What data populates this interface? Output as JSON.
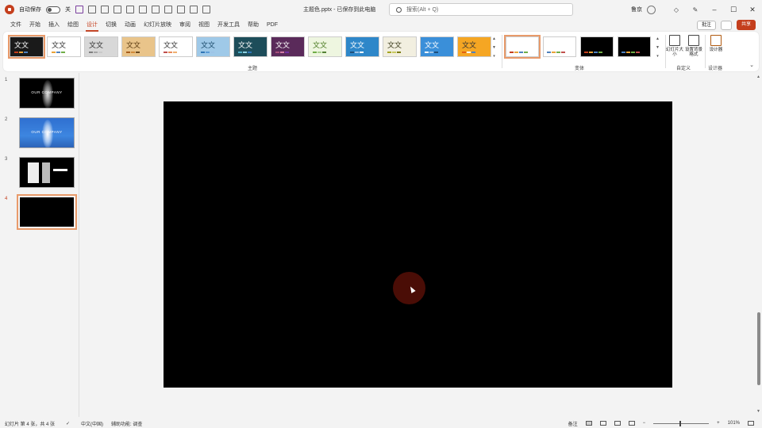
{
  "titlebar": {
    "autosave_label": "自动保存",
    "autosave_state": "关",
    "filename": "主题色.pptx - 已保存到此电脑",
    "search_placeholder": "搜索(Alt + Q)",
    "user_name": "鲁京",
    "win_min": "–",
    "win_max": "☐",
    "win_close": "✕"
  },
  "tabs": [
    "文件",
    "开始",
    "插入",
    "绘图",
    "设计",
    "切换",
    "动画",
    "幻灯片放映",
    "审阅",
    "视图",
    "开发工具",
    "帮助",
    "PDF"
  ],
  "active_tab": "设计",
  "share": {
    "comment": "批注",
    "share": "共享"
  },
  "ribbon": {
    "theme_label": "文文",
    "themes_group_label": "主题",
    "variants_group_label": "变体",
    "customize_group_label": "自定义",
    "designer_group_label": "设计器",
    "slide_size_label": "幻灯片大小",
    "format_bg_label": "设置背景格式",
    "designer_label": "设计器",
    "themes": [
      {
        "bg": "#1a1a1a",
        "fg": "#ffffff",
        "bars": [
          "#c43e1c",
          "#e8a33a",
          "#4f81bd"
        ]
      },
      {
        "bg": "#ffffff",
        "fg": "#333333",
        "bars": [
          "#e8a33a",
          "#4f81bd",
          "#70ad47"
        ]
      },
      {
        "bg": "#d8d8d8",
        "fg": "#333333",
        "bars": [
          "#7f7f7f",
          "#a6a6a6",
          "#c9c9c9"
        ]
      },
      {
        "bg": "#e9c48a",
        "fg": "#5a3a10",
        "bars": [
          "#a65c1c",
          "#d08a3a",
          "#6a4a20"
        ]
      },
      {
        "bg": "#ffffff",
        "fg": "#333333",
        "bars": [
          "#c0504d",
          "#e88a5a",
          "#f0b070"
        ]
      },
      {
        "bg": "#9fc9e8",
        "fg": "#1a4a6a",
        "bars": [
          "#2e75b6",
          "#5b9bd5",
          "#9dc3e6"
        ]
      },
      {
        "bg": "#1d4d5a",
        "fg": "#ffffff",
        "bars": [
          "#4bacc6",
          "#8cd0e0",
          "#2e75b6"
        ]
      },
      {
        "bg": "#5a2a5a",
        "fg": "#ffffff",
        "bars": [
          "#a64d79",
          "#d27ba6",
          "#7030a0"
        ]
      },
      {
        "bg": "#eef6e0",
        "fg": "#4a7a20",
        "bars": [
          "#70ad47",
          "#a9d18e",
          "#548235"
        ]
      },
      {
        "bg": "#2e87c9",
        "fg": "#ffffff",
        "bars": [
          "#1f4e79",
          "#9dc3e6",
          "#ffffff"
        ]
      },
      {
        "bg": "#f2efe0",
        "fg": "#3a3a1a",
        "bars": [
          "#a5a520",
          "#c9c960",
          "#7a7a10"
        ]
      },
      {
        "bg": "#3a8fd9",
        "fg": "#ffffff",
        "bars": [
          "#ffffff",
          "#9dc3e6",
          "#1f4e79"
        ]
      },
      {
        "bg": "#f5a623",
        "fg": "#333333",
        "bars": [
          "#e06010",
          "#ffffff",
          "#4f81bd"
        ]
      }
    ],
    "variants": [
      {
        "bg": "#ffffff",
        "bars": [
          "#c43e1c",
          "#e8a33a",
          "#4f81bd",
          "#70ad47"
        ]
      },
      {
        "bg": "#ffffff",
        "bars": [
          "#4f81bd",
          "#e8a33a",
          "#70ad47",
          "#c0504d"
        ]
      },
      {
        "bg": "#000000",
        "bars": [
          "#c43e1c",
          "#e8a33a",
          "#4f81bd",
          "#70ad47"
        ]
      },
      {
        "bg": "#000000",
        "bars": [
          "#4f81bd",
          "#e8a33a",
          "#70ad47",
          "#c0504d"
        ]
      }
    ]
  },
  "slides": [
    {
      "num": "1",
      "title": "OUR COMPANY",
      "style": "dark"
    },
    {
      "num": "2",
      "title": "OUR COMPANY",
      "style": "blue"
    },
    {
      "num": "3",
      "title": "",
      "style": "doc"
    },
    {
      "num": "4",
      "title": "",
      "style": "blank"
    }
  ],
  "selected_slide": 4,
  "status": {
    "slide_info": "幻灯片 第 4 张，共 4 张",
    "language": "中文(中国)",
    "accessibility": "辅助功能: 调查",
    "notes": "备注",
    "zoom": "101%"
  }
}
